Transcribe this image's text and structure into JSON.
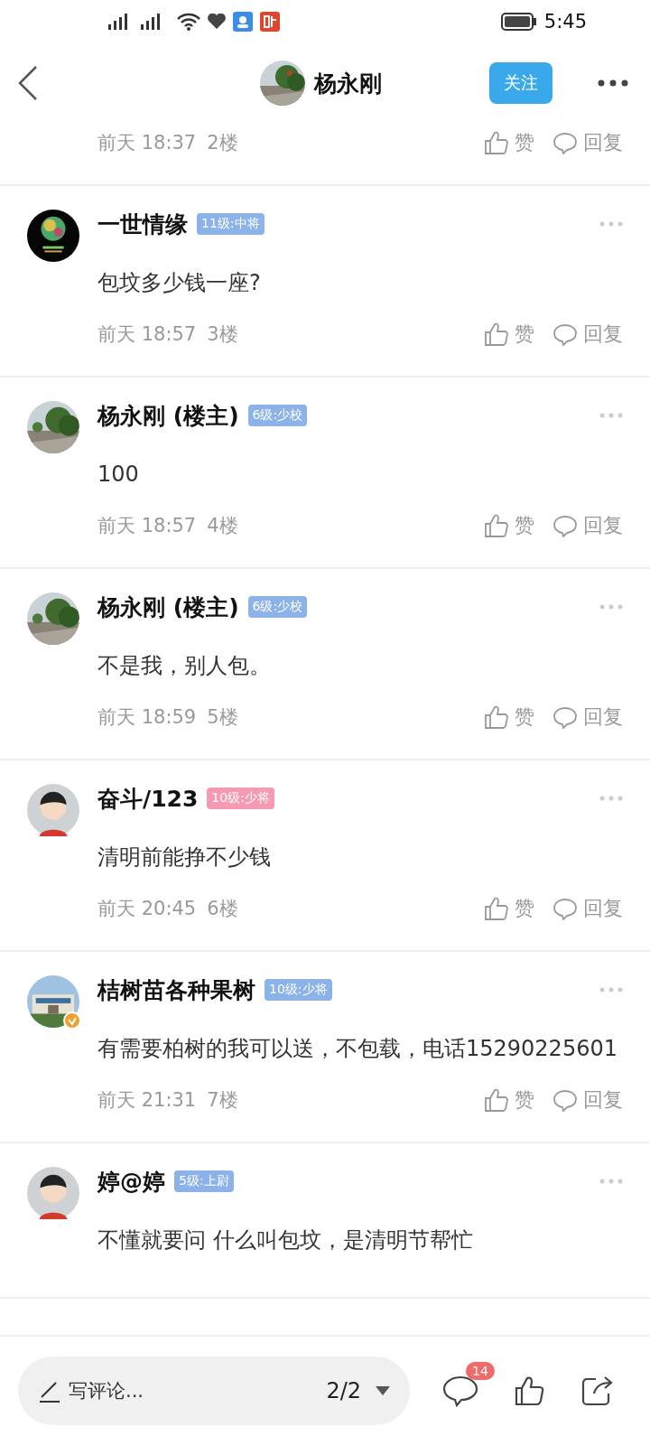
{
  "header": {
    "title": "杨永刚",
    "follow_button": "关注"
  },
  "partial_footer": {
    "time": "前天 18:37",
    "floor": "2楼",
    "like": "赞",
    "reply": "回复"
  },
  "comments": [
    {
      "name": "一世情缘",
      "badge": "11级:中将",
      "color": "#8cb2ea",
      "verified": false,
      "text": "包坟多少钱一座?",
      "time": "前天 18:57",
      "floor": "3楼",
      "like": "赞",
      "reply": "回复"
    },
    {
      "name": "杨永刚 (楼主)",
      "badge": "6级:少校",
      "color": "#8cb2ea",
      "verified": false,
      "text": "100",
      "time": "前天 18:57",
      "floor": "4楼",
      "like": "赞",
      "reply": "回复"
    },
    {
      "name": "杨永刚 (楼主)",
      "badge": "6级:少校",
      "color": "#8cb2ea",
      "verified": false,
      "text": "不是我，别人包。",
      "time": "前天 18:59",
      "floor": "5楼",
      "like": "赞",
      "reply": "回复"
    },
    {
      "name": "奋斗/123",
      "badge": "10级:少将",
      "color": "#f59ab2",
      "verified": false,
      "text": "清明前能挣不少钱",
      "time": "前天 20:45",
      "floor": "6楼",
      "like": "赞",
      "reply": "回复"
    },
    {
      "name": "桔树苗各种果树",
      "badge": "10级:少将",
      "color": "#8cb2ea",
      "verified": true,
      "text": "有需要柏树的我可以送，不包载，电话15290225601",
      "time": "前天 21:31",
      "floor": "7楼",
      "like": "赞",
      "reply": "回复"
    },
    {
      "name": "婷@婷",
      "badge": "5级:上尉",
      "color": "#8cb2ea",
      "verified": false,
      "text": "不懂就要问  什么叫包坟，是清明节帮忙"
    }
  ],
  "bottom_bar": {
    "comment_placeholder": "写评论...",
    "page": "2/2",
    "comment_count": "14"
  },
  "status_bar": {
    "time": "5:45"
  }
}
